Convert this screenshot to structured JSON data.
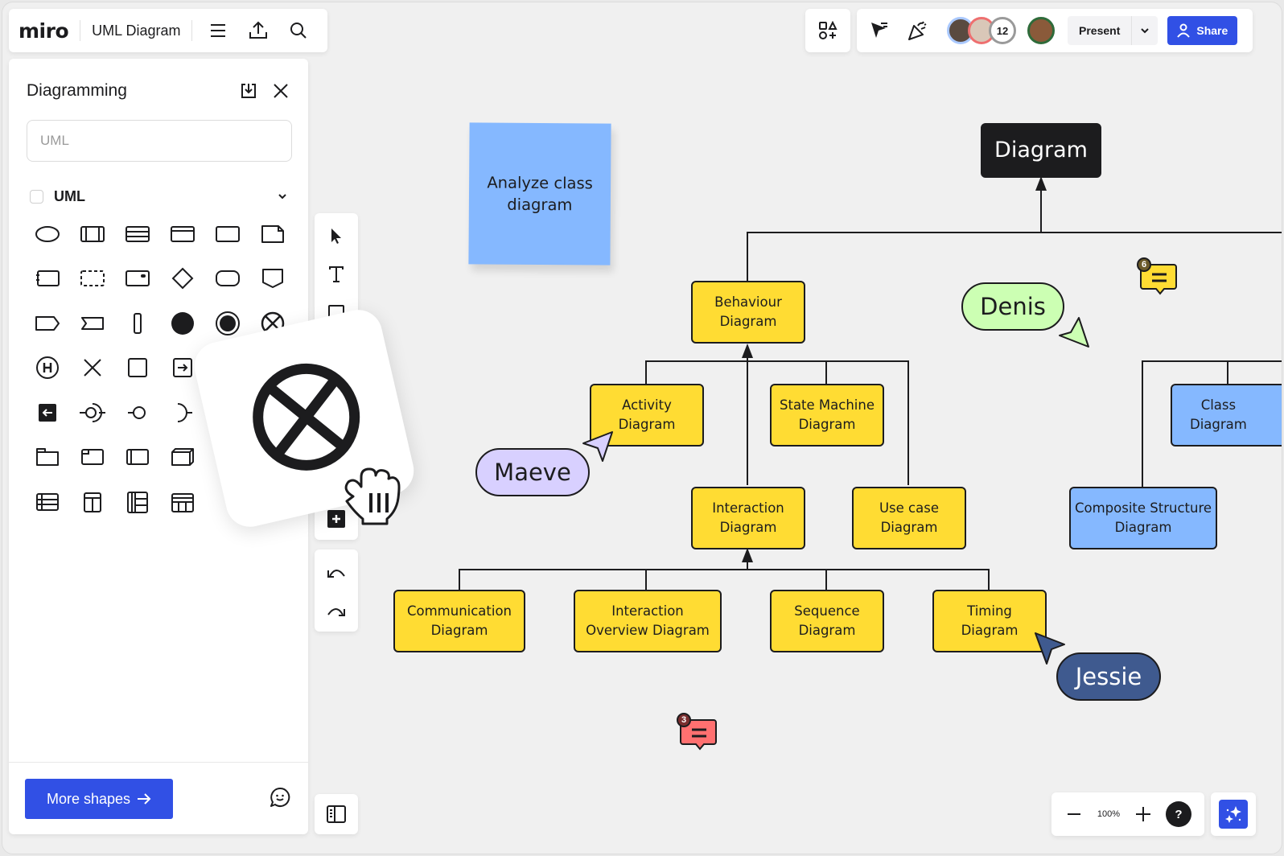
{
  "header": {
    "logo": "miro",
    "board_title": "UML Diagram",
    "menu_icon": "hamburger-menu-icon",
    "export_icon": "upload-icon",
    "search_icon": "search-icon"
  },
  "top_right": {
    "shapes_icon": "shapes-apps-icon",
    "reactions_icon": "cursor-follow-icon",
    "celebrate_icon": "party-popper-icon",
    "collaborator_count": "12",
    "present_label": "Present",
    "share_label": "Share"
  },
  "side_panel": {
    "title": "Diagramming",
    "search_placeholder": "UML",
    "category_label": "UML",
    "category_checked": false,
    "shapes": [
      "ellipse",
      "class-3col",
      "class-3row",
      "frame-header",
      "rectangle",
      "note",
      "component",
      "dashed-rectangle",
      "node-dot",
      "diamond",
      "rounded-rectangle",
      "pentagon-down",
      "send-signal",
      "accept-event",
      "bar",
      "initial-node",
      "final-node",
      "flow-final",
      "history",
      "cross",
      "square",
      "exit-arrow",
      "entry-arrow",
      "provided-required-interface",
      "provided-interface",
      "required-interface",
      "package",
      "package-tab",
      "rect-side",
      "3d-box",
      "table-row",
      "table-col",
      "table-grid",
      "table-header"
    ],
    "more_shapes_label": "More shapes"
  },
  "drag_preview": {
    "shape": "flow-final"
  },
  "toolbar": {
    "tools": [
      "select",
      "text",
      "sticky-note"
    ],
    "undo_icon": "undo-icon",
    "redo_icon": "redo-icon"
  },
  "canvas": {
    "sticky_note": "Analyze class\ndiagram",
    "nodes": {
      "root": "Diagram",
      "behaviour": "Behaviour\nDiagram",
      "activity": "Activity\nDiagram",
      "state_machine": "State Machine\nDiagram",
      "interaction": "Interaction\nDiagram",
      "use_case": "Use case\nDiagram",
      "communication": "Communication\nDiagram",
      "interaction_overview": "Interaction\nOverview Diagram",
      "sequence": "Sequence\nDiagram",
      "timing": "Timing\nDiagram",
      "class": "Class\nDiagram",
      "composite_structure": "Composite Structure\nDiagram"
    },
    "cursors": [
      {
        "name": "Denis",
        "color": "#ccffb3"
      },
      {
        "name": "Maeve",
        "color": "#d8d0ff"
      },
      {
        "name": "Jessie",
        "color": "#3f5a8f"
      }
    ],
    "comments": [
      {
        "count": "6",
        "color": "#ffdc33",
        "badge_color": "#6b5a2a"
      },
      {
        "count": "3",
        "color": "#ff7070",
        "badge_color": "#7a2e2e"
      }
    ]
  },
  "zoom_controls": {
    "zoom_level": "100%",
    "help_label": "?"
  },
  "colors": {
    "accent": "#3150e5",
    "sticky_yellow": "#ffdc33",
    "sticky_blue": "#85b8ff",
    "canvas_bg": "#f0f0f0"
  }
}
